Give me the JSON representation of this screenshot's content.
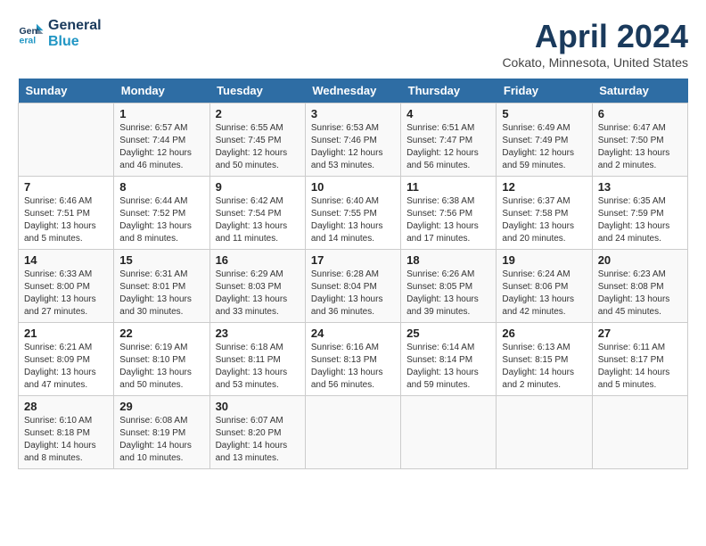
{
  "header": {
    "logo_line1": "General",
    "logo_line2": "Blue",
    "month_title": "April 2024",
    "location": "Cokato, Minnesota, United States"
  },
  "days_of_week": [
    "Sunday",
    "Monday",
    "Tuesday",
    "Wednesday",
    "Thursday",
    "Friday",
    "Saturday"
  ],
  "weeks": [
    [
      {
        "day": "",
        "info": ""
      },
      {
        "day": "1",
        "info": "Sunrise: 6:57 AM\nSunset: 7:44 PM\nDaylight: 12 hours\nand 46 minutes."
      },
      {
        "day": "2",
        "info": "Sunrise: 6:55 AM\nSunset: 7:45 PM\nDaylight: 12 hours\nand 50 minutes."
      },
      {
        "day": "3",
        "info": "Sunrise: 6:53 AM\nSunset: 7:46 PM\nDaylight: 12 hours\nand 53 minutes."
      },
      {
        "day": "4",
        "info": "Sunrise: 6:51 AM\nSunset: 7:47 PM\nDaylight: 12 hours\nand 56 minutes."
      },
      {
        "day": "5",
        "info": "Sunrise: 6:49 AM\nSunset: 7:49 PM\nDaylight: 12 hours\nand 59 minutes."
      },
      {
        "day": "6",
        "info": "Sunrise: 6:47 AM\nSunset: 7:50 PM\nDaylight: 13 hours\nand 2 minutes."
      }
    ],
    [
      {
        "day": "7",
        "info": "Sunrise: 6:46 AM\nSunset: 7:51 PM\nDaylight: 13 hours\nand 5 minutes."
      },
      {
        "day": "8",
        "info": "Sunrise: 6:44 AM\nSunset: 7:52 PM\nDaylight: 13 hours\nand 8 minutes."
      },
      {
        "day": "9",
        "info": "Sunrise: 6:42 AM\nSunset: 7:54 PM\nDaylight: 13 hours\nand 11 minutes."
      },
      {
        "day": "10",
        "info": "Sunrise: 6:40 AM\nSunset: 7:55 PM\nDaylight: 13 hours\nand 14 minutes."
      },
      {
        "day": "11",
        "info": "Sunrise: 6:38 AM\nSunset: 7:56 PM\nDaylight: 13 hours\nand 17 minutes."
      },
      {
        "day": "12",
        "info": "Sunrise: 6:37 AM\nSunset: 7:58 PM\nDaylight: 13 hours\nand 20 minutes."
      },
      {
        "day": "13",
        "info": "Sunrise: 6:35 AM\nSunset: 7:59 PM\nDaylight: 13 hours\nand 24 minutes."
      }
    ],
    [
      {
        "day": "14",
        "info": "Sunrise: 6:33 AM\nSunset: 8:00 PM\nDaylight: 13 hours\nand 27 minutes."
      },
      {
        "day": "15",
        "info": "Sunrise: 6:31 AM\nSunset: 8:01 PM\nDaylight: 13 hours\nand 30 minutes."
      },
      {
        "day": "16",
        "info": "Sunrise: 6:29 AM\nSunset: 8:03 PM\nDaylight: 13 hours\nand 33 minutes."
      },
      {
        "day": "17",
        "info": "Sunrise: 6:28 AM\nSunset: 8:04 PM\nDaylight: 13 hours\nand 36 minutes."
      },
      {
        "day": "18",
        "info": "Sunrise: 6:26 AM\nSunset: 8:05 PM\nDaylight: 13 hours\nand 39 minutes."
      },
      {
        "day": "19",
        "info": "Sunrise: 6:24 AM\nSunset: 8:06 PM\nDaylight: 13 hours\nand 42 minutes."
      },
      {
        "day": "20",
        "info": "Sunrise: 6:23 AM\nSunset: 8:08 PM\nDaylight: 13 hours\nand 45 minutes."
      }
    ],
    [
      {
        "day": "21",
        "info": "Sunrise: 6:21 AM\nSunset: 8:09 PM\nDaylight: 13 hours\nand 47 minutes."
      },
      {
        "day": "22",
        "info": "Sunrise: 6:19 AM\nSunset: 8:10 PM\nDaylight: 13 hours\nand 50 minutes."
      },
      {
        "day": "23",
        "info": "Sunrise: 6:18 AM\nSunset: 8:11 PM\nDaylight: 13 hours\nand 53 minutes."
      },
      {
        "day": "24",
        "info": "Sunrise: 6:16 AM\nSunset: 8:13 PM\nDaylight: 13 hours\nand 56 minutes."
      },
      {
        "day": "25",
        "info": "Sunrise: 6:14 AM\nSunset: 8:14 PM\nDaylight: 13 hours\nand 59 minutes."
      },
      {
        "day": "26",
        "info": "Sunrise: 6:13 AM\nSunset: 8:15 PM\nDaylight: 14 hours\nand 2 minutes."
      },
      {
        "day": "27",
        "info": "Sunrise: 6:11 AM\nSunset: 8:17 PM\nDaylight: 14 hours\nand 5 minutes."
      }
    ],
    [
      {
        "day": "28",
        "info": "Sunrise: 6:10 AM\nSunset: 8:18 PM\nDaylight: 14 hours\nand 8 minutes."
      },
      {
        "day": "29",
        "info": "Sunrise: 6:08 AM\nSunset: 8:19 PM\nDaylight: 14 hours\nand 10 minutes."
      },
      {
        "day": "30",
        "info": "Sunrise: 6:07 AM\nSunset: 8:20 PM\nDaylight: 14 hours\nand 13 minutes."
      },
      {
        "day": "",
        "info": ""
      },
      {
        "day": "",
        "info": ""
      },
      {
        "day": "",
        "info": ""
      },
      {
        "day": "",
        "info": ""
      }
    ]
  ]
}
